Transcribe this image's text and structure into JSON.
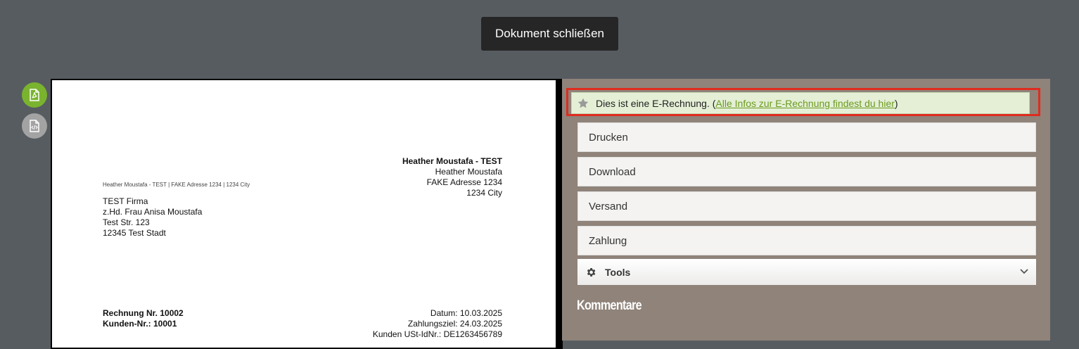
{
  "header": {
    "close_label": "Dokument schließen"
  },
  "side_icons": [
    {
      "name": "pdf-file-icon",
      "color": "#7ab32e"
    },
    {
      "name": "xml-file-icon",
      "color": "#a3a3a3"
    }
  ],
  "document": {
    "sender": {
      "title": "Heather Moustafa - TEST",
      "name": "Heather Moustafa",
      "street": "FAKE Adresse 1234",
      "city": "1234 City"
    },
    "sender_line": "Heather Moustafa - TEST | FAKE Adresse 1234 | 1234 City",
    "recipient": {
      "company": "TEST Firma",
      "attn": "z.Hd. Frau Anisa Moustafa",
      "street": "Test Str. 123",
      "city": "12345 Test Stadt"
    },
    "invoice": {
      "number": "Rechnung Nr. 10002",
      "customer": "Kunden-Nr.: 10001",
      "date": "Datum: 10.03.2025",
      "due": "Zahlungsziel: 24.03.2025",
      "vat_id": "Kunden USt-IdNr.: DE1263456789"
    }
  },
  "panel": {
    "info": {
      "text": "Dies ist eine E-Rechnung. (",
      "link": "Alle Infos zur E-Rechnung findest du hier",
      "suffix": ")"
    },
    "actions": [
      "Drucken",
      "Download",
      "Versand",
      "Zahlung"
    ],
    "tools_label": "Tools",
    "comments_title": "Kommentare"
  },
  "colors": {
    "highlight": "#e02b1f",
    "accent": "#7ab32e",
    "panel_bg": "#8f837a"
  }
}
